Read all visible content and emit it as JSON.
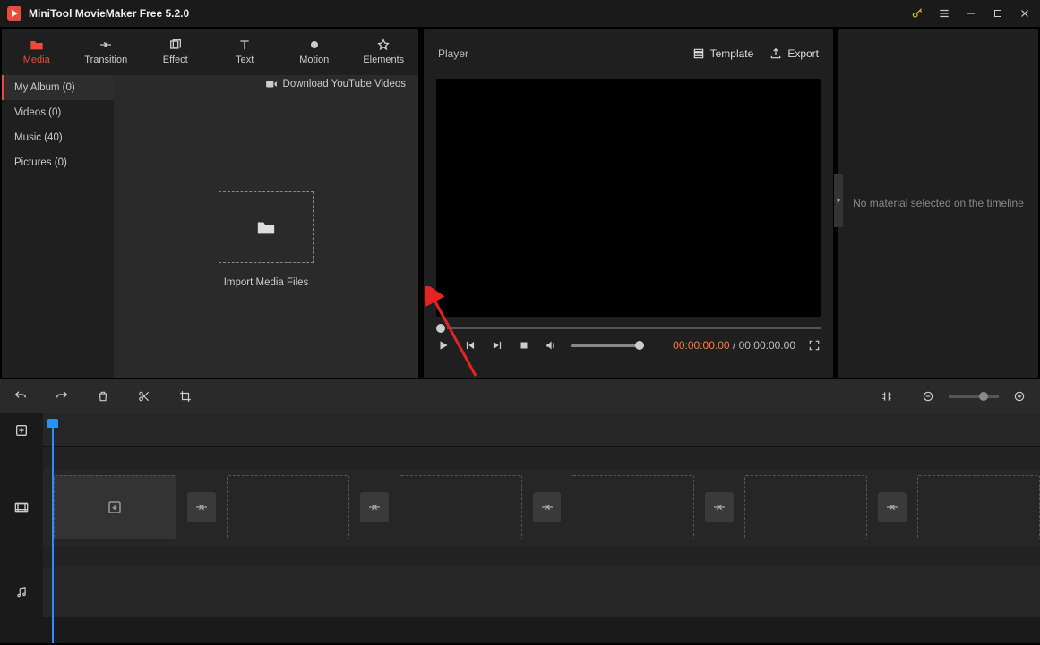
{
  "app": {
    "title": "MiniTool MovieMaker Free 5.2.0"
  },
  "tabs": [
    {
      "label": "Media"
    },
    {
      "label": "Transition"
    },
    {
      "label": "Effect"
    },
    {
      "label": "Text"
    },
    {
      "label": "Motion"
    },
    {
      "label": "Elements"
    }
  ],
  "sidebar": [
    {
      "label": "My Album (0)"
    },
    {
      "label": "Videos (0)"
    },
    {
      "label": "Music (40)"
    },
    {
      "label": "Pictures (0)"
    }
  ],
  "mediaArea": {
    "downloadLink": "Download YouTube Videos",
    "importLabel": "Import Media Files"
  },
  "player": {
    "title": "Player",
    "template": "Template",
    "export": "Export",
    "currentTime": "00:00:00.00",
    "separator": "/",
    "totalTime": "00:00:00.00"
  },
  "rightPanel": {
    "message": "No material selected on the timeline"
  }
}
